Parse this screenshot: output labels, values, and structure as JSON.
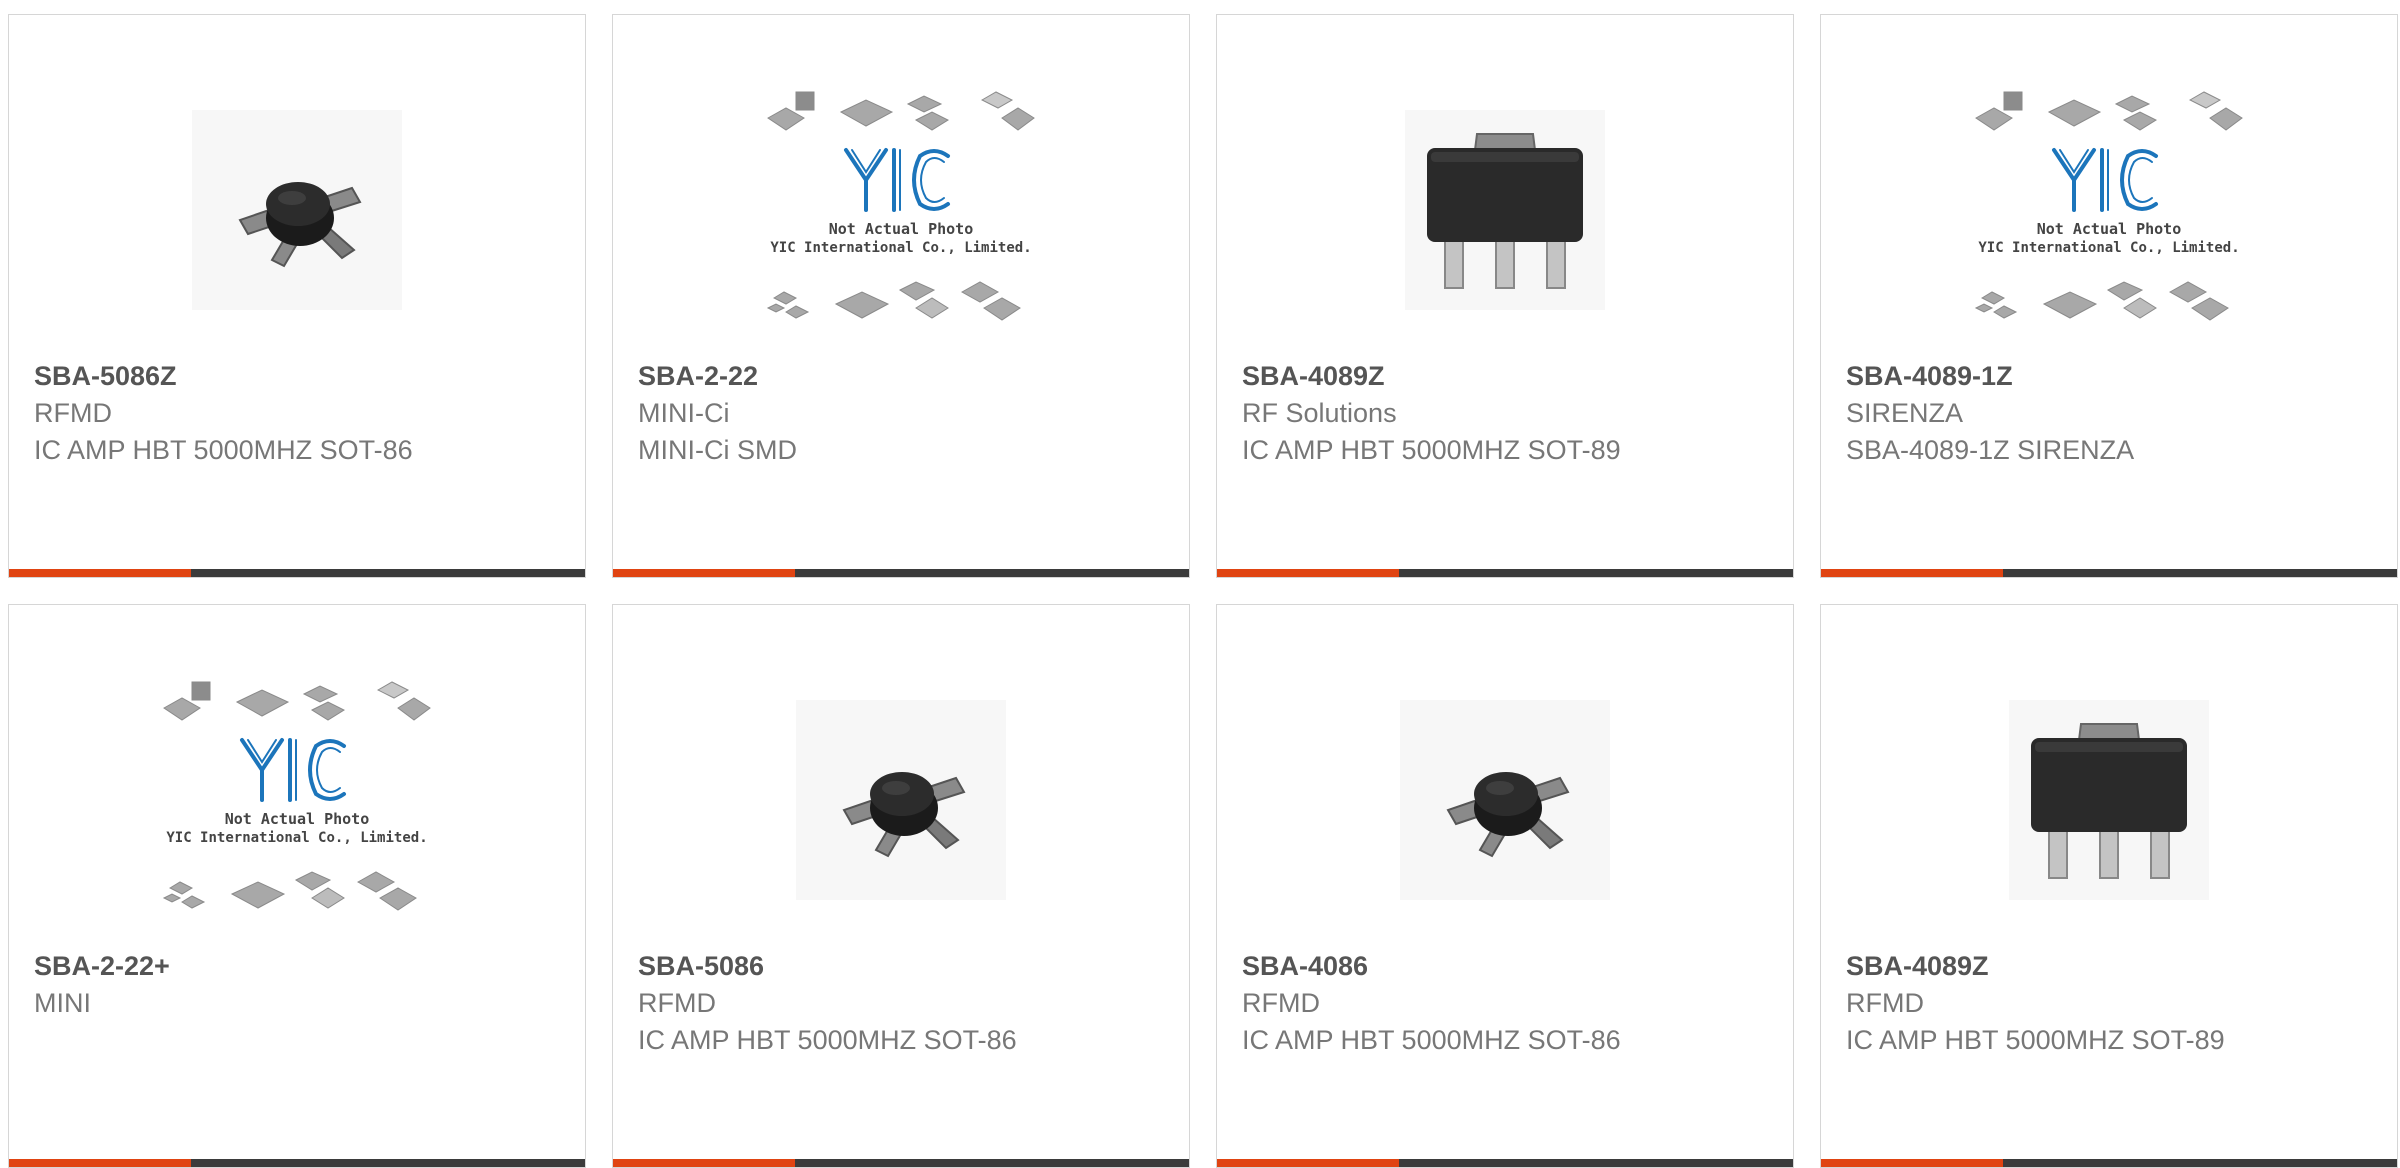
{
  "colors": {
    "accent": "#e04412",
    "bar_dark": "#3b3b3b",
    "title": "#555555",
    "text": "#777777",
    "yic_blue": "#1c75bb"
  },
  "placeholder": {
    "line1": "Not Actual Photo",
    "line2": "YIC International Co., Limited."
  },
  "products": [
    {
      "part_number": "SBA-5086Z",
      "manufacturer": "RFMD",
      "description": "IC AMP HBT 5000MHZ SOT-86",
      "image": "sot-86-package-icon"
    },
    {
      "part_number": "SBA-2-22",
      "manufacturer": "MINI-Ci",
      "description": "MINI-Ci SMD",
      "image": "placeholder-logo"
    },
    {
      "part_number": "SBA-4089Z",
      "manufacturer": "RF Solutions",
      "description": "IC AMP HBT 5000MHZ SOT-89",
      "image": "sot-89-package-icon"
    },
    {
      "part_number": "SBA-4089-1Z",
      "manufacturer": "SIRENZA",
      "description": "SBA-4089-1Z SIRENZA",
      "image": "placeholder-logo"
    },
    {
      "part_number": "SBA-2-22+",
      "manufacturer": "MINI",
      "description": "",
      "image": "placeholder-logo"
    },
    {
      "part_number": "SBA-5086",
      "manufacturer": "RFMD",
      "description": "IC AMP HBT 5000MHZ SOT-86",
      "image": "sot-86-package-icon"
    },
    {
      "part_number": "SBA-4086",
      "manufacturer": "RFMD",
      "description": "IC AMP HBT 5000MHZ SOT-86",
      "image": "sot-86-package-icon"
    },
    {
      "part_number": "SBA-4089Z",
      "manufacturer": "RFMD",
      "description": "IC AMP HBT 5000MHZ SOT-89",
      "image": "sot-89-package-icon"
    }
  ]
}
